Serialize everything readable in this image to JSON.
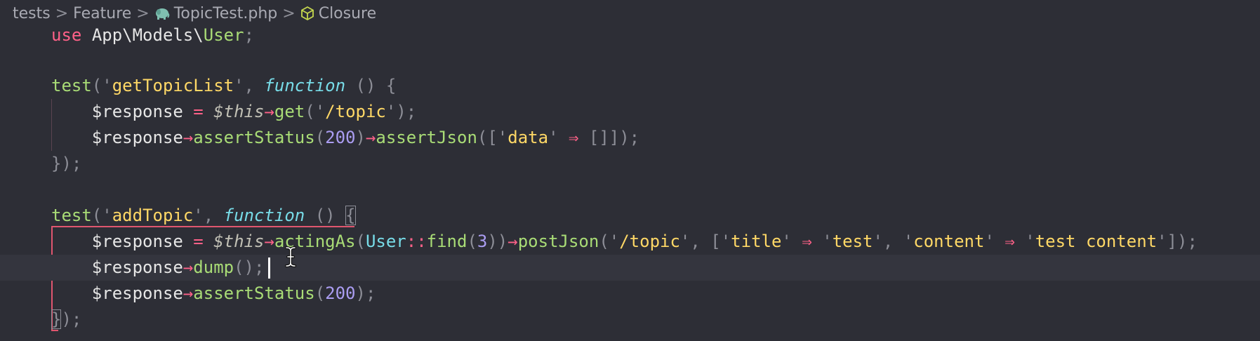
{
  "breadcrumb": {
    "items": [
      "tests",
      "Feature",
      "TopicTest.php",
      "Closure"
    ],
    "separator": ">",
    "file_icon": "php-elephant-icon",
    "symbol_icon": "cube-icon"
  },
  "colors": {
    "background": "#2d2e36",
    "current_line": "#34353e",
    "keyword": "#ff6188",
    "function_name": "#a9dc76",
    "string": "#ffd866",
    "type": "#78dce8",
    "number": "#ab9df2",
    "guide": "#e0566f"
  },
  "code": {
    "l1": {
      "use": "use",
      "ns": "App\\Models\\",
      "cls": "User",
      "semi": ";"
    },
    "l3": {
      "fn": "test",
      "p1": "('",
      "name": "getTopicList",
      "p2": "', ",
      "kw": "function",
      "p3": " () {"
    },
    "l4": {
      "var": "$response",
      "eq": " = ",
      "this": "$this",
      "arrow": "→",
      "method": "get",
      "p1": "('",
      "path": "/topic",
      "p2": "');"
    },
    "l5": {
      "var": "$response",
      "arrow1": "→",
      "m1": "assertStatus",
      "p1": "(",
      "n1": "200",
      "p2": ")",
      "arrow2": "→",
      "m2": "assertJson",
      "p3": "(['",
      "key": "data",
      "p4": "' ",
      "darrow": "⇒",
      "p5": " []]);"
    },
    "l6": {
      "close": "});"
    },
    "l8": {
      "fn": "test",
      "p1": "('",
      "name": "addTopic",
      "p2": "', ",
      "kw": "function",
      "p3": " () ",
      "brace": "{"
    },
    "l9": {
      "var": "$response",
      "eq": " = ",
      "this": "$this",
      "arrow1": "→",
      "m1": "actingAs",
      "p1": "(",
      "cls": "User",
      "dc": "::",
      "m2": "find",
      "p2": "(",
      "n1": "3",
      "p3": "))",
      "arrow2": "→",
      "m3": "postJson",
      "p4": "('",
      "path": "/topic",
      "p5": "', ['",
      "k1": "title",
      "p6": "' ",
      "da1": "⇒",
      "p7": " '",
      "v1": "test",
      "p8": "', '",
      "k2": "content",
      "p9": "' ",
      "da2": "⇒",
      "p10": " '",
      "v2": "test content",
      "p11": "']);"
    },
    "l10": {
      "var": "$response",
      "arrow": "→",
      "method": "dump",
      "p": "();"
    },
    "l11": {
      "var": "$response",
      "arrow": "→",
      "method": "assertStatus",
      "p1": "(",
      "n1": "200",
      "p2": ");"
    },
    "l12": {
      "brace": "}",
      "rest": ");"
    }
  }
}
